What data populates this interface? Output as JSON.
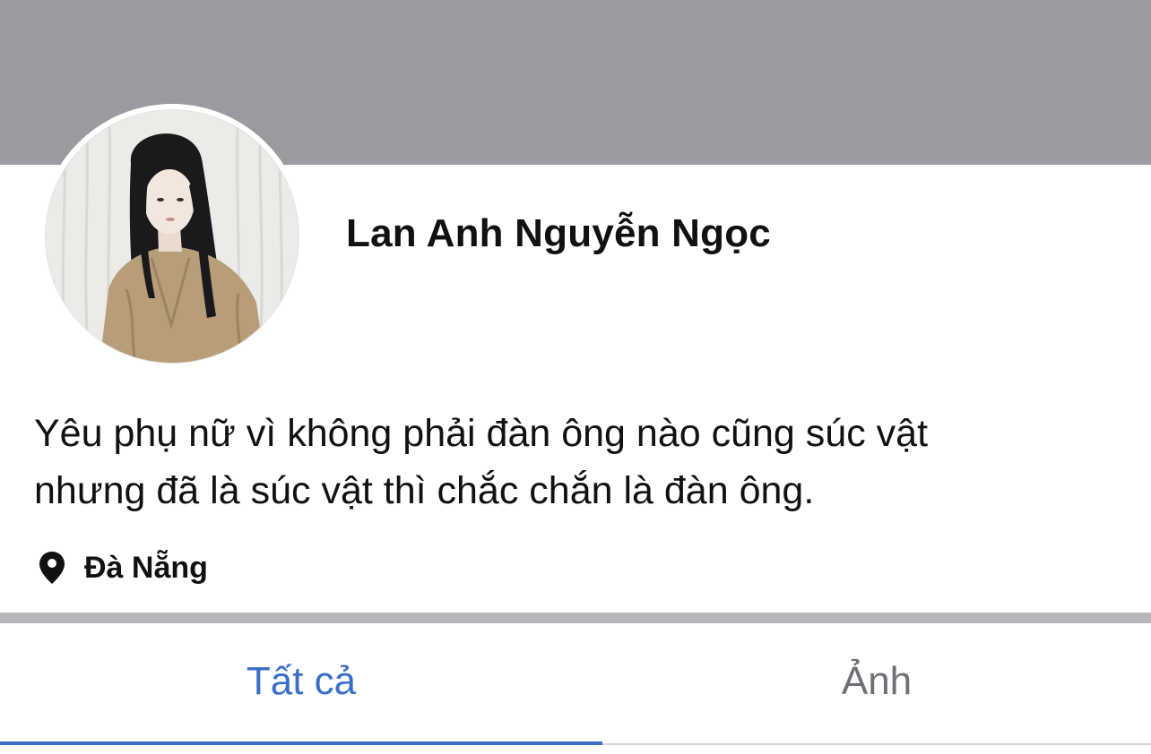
{
  "profile": {
    "name": "Lan Anh Nguyễn Ngọc",
    "avatar_icon": "profile-photo",
    "bio_lines": [
      "Yêu phụ nữ vì không phải đàn ông nào cũng súc vật",
      "nhưng đã là súc vật thì chắc chắn là đàn ông."
    ],
    "location": {
      "icon": "map-pin-icon",
      "text": "Đà Nẵng"
    }
  },
  "tabs": [
    {
      "label": "Tất cả",
      "active": true
    },
    {
      "label": "Ảnh",
      "active": false
    }
  ],
  "colors": {
    "cover": "#9a9ba0",
    "accent": "#3b6fc7",
    "text": "#111111",
    "inactive_tab": "#6f7075",
    "divider": "#b5b6b9"
  }
}
